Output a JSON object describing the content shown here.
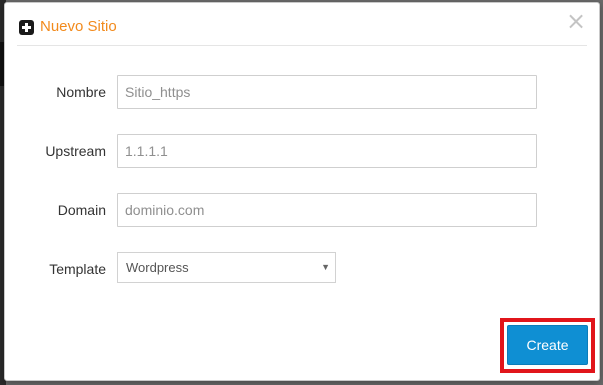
{
  "modal": {
    "title": "Nuevo Sitio",
    "title_icon": "plus-square-icon",
    "close_symbol": "×"
  },
  "form": {
    "nombre": {
      "label": "Nombre",
      "value": "",
      "placeholder": "Sitio_https"
    },
    "upstream": {
      "label": "Upstream",
      "value": "",
      "placeholder": "1.1.1.1"
    },
    "domain": {
      "label": "Domain",
      "value": "",
      "placeholder": "dominio.com"
    },
    "template": {
      "label": "Template",
      "selected": "Wordpress",
      "caret": "▼"
    }
  },
  "actions": {
    "create_label": "Create"
  },
  "colors": {
    "title": "#f28a1c",
    "primary_button": "#0f8fd3",
    "highlight": "#e1151b"
  }
}
